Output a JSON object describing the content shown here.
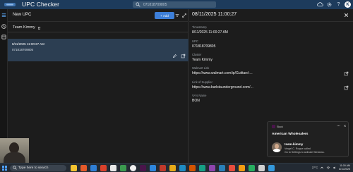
{
  "app": {
    "title": "UPC Checker",
    "search_value": "071818709805"
  },
  "list_panel": {
    "title": "New UPC",
    "add_label": "Add",
    "group_name": "Team Kimmy",
    "card": {
      "date": "8/11/2025 11:00:27 AM",
      "upc": "071818709805"
    }
  },
  "detail": {
    "title": "08/11/2025 11:00:27",
    "fields": [
      {
        "label": "Timestamp",
        "value": "8/11/2025 11:00:27 AM"
      },
      {
        "label": "UPC",
        "value": "071818709805"
      },
      {
        "label": "Cluster",
        "value": "Team Kimmy"
      },
      {
        "label": "Walmart Link",
        "value": "https://www.walmart.com/ip/Guittard-..."
      },
      {
        "label": "Link of Supplier",
        "value": "https://www.barlstaunderground.com/..."
      },
      {
        "label": "VA's Name",
        "value": "BON"
      }
    ]
  },
  "notification": {
    "app": "Slack",
    "group": "American Wholesalers",
    "sender": "team-kimmy",
    "line1": "Vergel C. Roque called",
    "line2": "Go to Settings to activate Windows."
  },
  "taskbar": {
    "search_placeholder": "Type here to search",
    "weather": "27°C",
    "time": "11:00 AM",
    "date": "8/11/2025"
  },
  "colors": {
    "app_bar": "#1d3b5c",
    "accent": "#3d7fd9",
    "selected_card": "#2c3e52",
    "background": "#1c1c1c"
  }
}
